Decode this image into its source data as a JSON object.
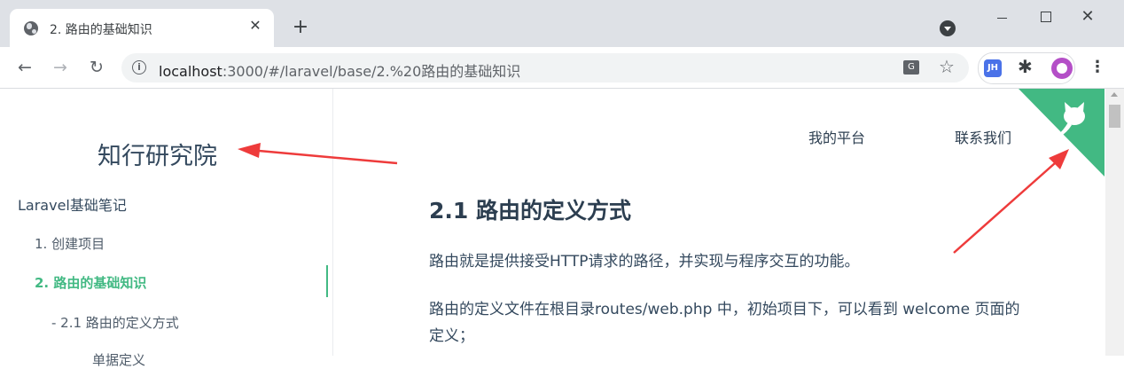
{
  "browser": {
    "tab_title": "2. 路由的基础知识",
    "tab_close": "✕",
    "new_tab": "+",
    "url_host": "localhost",
    "url_path": ":3000/#/laravel/base/2.%20路由的基础知识",
    "extension_label": "JH",
    "icons": [
      "globe-icon",
      "close-icon",
      "plus-icon",
      "tab-search-icon",
      "back-icon",
      "forward-icon",
      "reload-icon",
      "info-icon",
      "translate-icon",
      "star-icon",
      "puzzle-icon",
      "avatar-icon",
      "more-icon"
    ]
  },
  "sidebar": {
    "site_title": "知行研究院",
    "top_item": "Laravel基础笔记",
    "items": [
      {
        "label": "1. 创建项目"
      },
      {
        "label": "2. 路由的基础知识",
        "active": true
      },
      {
        "label": "- 2.1 路由的定义方式"
      },
      {
        "label": "单据定义"
      }
    ]
  },
  "nav": {
    "platform": "我的平台",
    "contact": "联系我们"
  },
  "content": {
    "heading": "2.1 路由的定义方式",
    "para1": "路由就是提供接受HTTP请求的路径，并实现与程序交互的功能。",
    "para2": "路由的定义文件在根目录routes/web.php 中，初始项目下，可以看到 welcome 页面的定义；"
  },
  "colors": {
    "accent": "#42b983",
    "annotation": "#ee3b3b"
  }
}
